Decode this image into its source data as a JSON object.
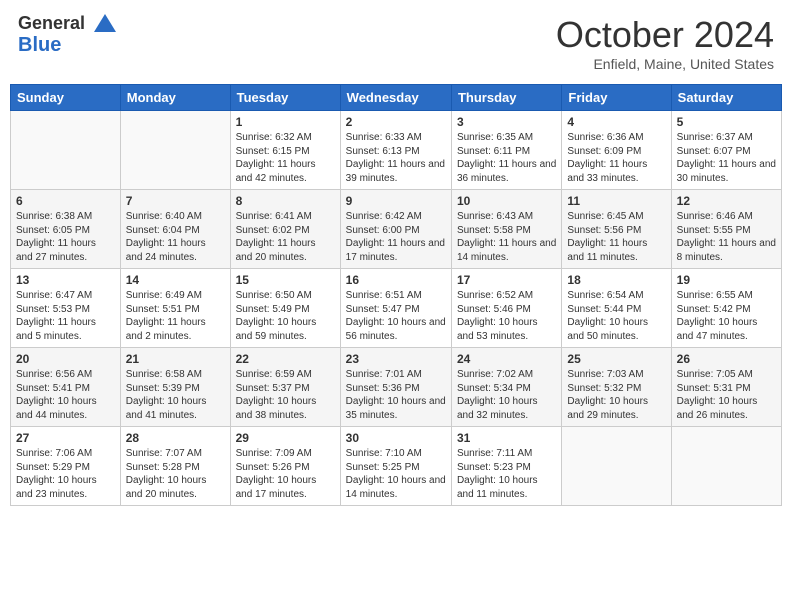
{
  "header": {
    "logo_line1": "General",
    "logo_line2": "Blue",
    "month": "October 2024",
    "location": "Enfield, Maine, United States"
  },
  "days_of_week": [
    "Sunday",
    "Monday",
    "Tuesday",
    "Wednesday",
    "Thursday",
    "Friday",
    "Saturday"
  ],
  "weeks": [
    [
      {
        "day": "",
        "content": ""
      },
      {
        "day": "",
        "content": ""
      },
      {
        "day": "1",
        "content": "Sunrise: 6:32 AM\nSunset: 6:15 PM\nDaylight: 11 hours and 42 minutes."
      },
      {
        "day": "2",
        "content": "Sunrise: 6:33 AM\nSunset: 6:13 PM\nDaylight: 11 hours and 39 minutes."
      },
      {
        "day": "3",
        "content": "Sunrise: 6:35 AM\nSunset: 6:11 PM\nDaylight: 11 hours and 36 minutes."
      },
      {
        "day": "4",
        "content": "Sunrise: 6:36 AM\nSunset: 6:09 PM\nDaylight: 11 hours and 33 minutes."
      },
      {
        "day": "5",
        "content": "Sunrise: 6:37 AM\nSunset: 6:07 PM\nDaylight: 11 hours and 30 minutes."
      }
    ],
    [
      {
        "day": "6",
        "content": "Sunrise: 6:38 AM\nSunset: 6:05 PM\nDaylight: 11 hours and 27 minutes."
      },
      {
        "day": "7",
        "content": "Sunrise: 6:40 AM\nSunset: 6:04 PM\nDaylight: 11 hours and 24 minutes."
      },
      {
        "day": "8",
        "content": "Sunrise: 6:41 AM\nSunset: 6:02 PM\nDaylight: 11 hours and 20 minutes."
      },
      {
        "day": "9",
        "content": "Sunrise: 6:42 AM\nSunset: 6:00 PM\nDaylight: 11 hours and 17 minutes."
      },
      {
        "day": "10",
        "content": "Sunrise: 6:43 AM\nSunset: 5:58 PM\nDaylight: 11 hours and 14 minutes."
      },
      {
        "day": "11",
        "content": "Sunrise: 6:45 AM\nSunset: 5:56 PM\nDaylight: 11 hours and 11 minutes."
      },
      {
        "day": "12",
        "content": "Sunrise: 6:46 AM\nSunset: 5:55 PM\nDaylight: 11 hours and 8 minutes."
      }
    ],
    [
      {
        "day": "13",
        "content": "Sunrise: 6:47 AM\nSunset: 5:53 PM\nDaylight: 11 hours and 5 minutes."
      },
      {
        "day": "14",
        "content": "Sunrise: 6:49 AM\nSunset: 5:51 PM\nDaylight: 11 hours and 2 minutes."
      },
      {
        "day": "15",
        "content": "Sunrise: 6:50 AM\nSunset: 5:49 PM\nDaylight: 10 hours and 59 minutes."
      },
      {
        "day": "16",
        "content": "Sunrise: 6:51 AM\nSunset: 5:47 PM\nDaylight: 10 hours and 56 minutes."
      },
      {
        "day": "17",
        "content": "Sunrise: 6:52 AM\nSunset: 5:46 PM\nDaylight: 10 hours and 53 minutes."
      },
      {
        "day": "18",
        "content": "Sunrise: 6:54 AM\nSunset: 5:44 PM\nDaylight: 10 hours and 50 minutes."
      },
      {
        "day": "19",
        "content": "Sunrise: 6:55 AM\nSunset: 5:42 PM\nDaylight: 10 hours and 47 minutes."
      }
    ],
    [
      {
        "day": "20",
        "content": "Sunrise: 6:56 AM\nSunset: 5:41 PM\nDaylight: 10 hours and 44 minutes."
      },
      {
        "day": "21",
        "content": "Sunrise: 6:58 AM\nSunset: 5:39 PM\nDaylight: 10 hours and 41 minutes."
      },
      {
        "day": "22",
        "content": "Sunrise: 6:59 AM\nSunset: 5:37 PM\nDaylight: 10 hours and 38 minutes."
      },
      {
        "day": "23",
        "content": "Sunrise: 7:01 AM\nSunset: 5:36 PM\nDaylight: 10 hours and 35 minutes."
      },
      {
        "day": "24",
        "content": "Sunrise: 7:02 AM\nSunset: 5:34 PM\nDaylight: 10 hours and 32 minutes."
      },
      {
        "day": "25",
        "content": "Sunrise: 7:03 AM\nSunset: 5:32 PM\nDaylight: 10 hours and 29 minutes."
      },
      {
        "day": "26",
        "content": "Sunrise: 7:05 AM\nSunset: 5:31 PM\nDaylight: 10 hours and 26 minutes."
      }
    ],
    [
      {
        "day": "27",
        "content": "Sunrise: 7:06 AM\nSunset: 5:29 PM\nDaylight: 10 hours and 23 minutes."
      },
      {
        "day": "28",
        "content": "Sunrise: 7:07 AM\nSunset: 5:28 PM\nDaylight: 10 hours and 20 minutes."
      },
      {
        "day": "29",
        "content": "Sunrise: 7:09 AM\nSunset: 5:26 PM\nDaylight: 10 hours and 17 minutes."
      },
      {
        "day": "30",
        "content": "Sunrise: 7:10 AM\nSunset: 5:25 PM\nDaylight: 10 hours and 14 minutes."
      },
      {
        "day": "31",
        "content": "Sunrise: 7:11 AM\nSunset: 5:23 PM\nDaylight: 10 hours and 11 minutes."
      },
      {
        "day": "",
        "content": ""
      },
      {
        "day": "",
        "content": ""
      }
    ]
  ]
}
